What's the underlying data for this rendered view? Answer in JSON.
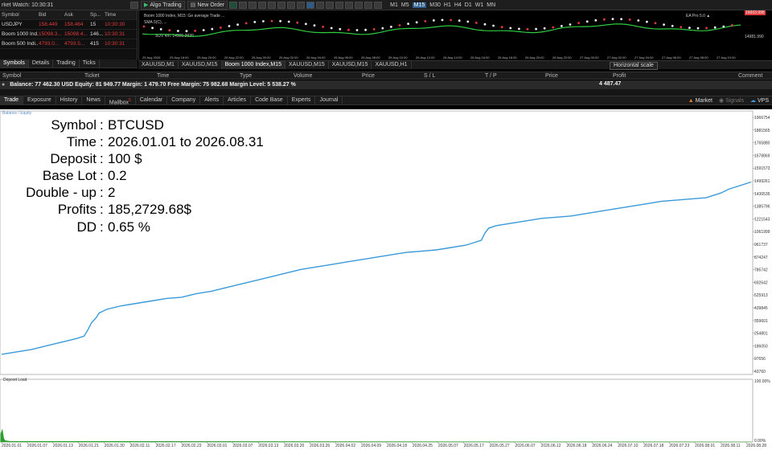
{
  "toolbar": {
    "market_watch_title": "rket Watch: 10:30:31",
    "algo_trading": "Algo Trading",
    "new_order": "New Order",
    "timeframes": [
      "M1",
      "M5",
      "M15",
      "M30",
      "H1",
      "H4",
      "D1",
      "W1",
      "MN"
    ],
    "active_timeframe": "M15"
  },
  "market_watch": {
    "headers": {
      "symbol": "Symbol",
      "bid": "Bid",
      "ask": "Ask",
      "spread": "Sp...",
      "time": "Time"
    },
    "rows": [
      {
        "symbol": "USDJPY",
        "bid": "158.449",
        "ask": "158.464",
        "spread": "15",
        "time": "10:30:30"
      },
      {
        "symbol": "Boom 1000 Ind...",
        "bid": "15098.3...",
        "ask": "15098.4...",
        "spread": "146...",
        "time": "10:30:31"
      },
      {
        "symbol": "Boom 500 Indi...",
        "bid": "4793.0...",
        "ask": "4793.5...",
        "spread": "415",
        "time": "10:30:31"
      }
    ],
    "tabs": [
      "Symbols",
      "Details",
      "Trading",
      "Ticks"
    ]
  },
  "mini_chart": {
    "line1": "Boom 1000 Index, M15:  Ge average  Trade ...",
    "line2": "SMA 5(C), ...",
    "line3": "SUV 4m: 14905.2930",
    "right_label": "EA Pro 5.0 ▲",
    "right_price1": "16003.995",
    "right_price2": "14981.990",
    "x_labels": [
      "25 Aug 2026",
      "25 Aug 18:00",
      "25 Aug 20:00",
      "25 Aug 22:00",
      "26 Aug 00:00",
      "26 Aug 02:00",
      "26 Aug 04:00",
      "26 Aug 06:00",
      "26 Aug 08:00",
      "26 Aug 10:00",
      "26 Aug 12:00",
      "26 Aug 14:00",
      "26 Aug 16:00",
      "26 Aug 18:00",
      "26 Aug 20:00",
      "26 Aug 22:00",
      "27 Aug 00:00",
      "27 Aug 02:00",
      "27 Aug 04:00",
      "27 Aug 06:00",
      "27 Aug 08:00",
      "27 Aug 10:00"
    ]
  },
  "chart_tabs": [
    "XAUUSD,M1",
    "XAUUSD,M15",
    "Boom 1000 Index,M15",
    "XAUUSD,M15",
    "XAUUSD,M15",
    "XAUUSD,H1"
  ],
  "active_chart_tab": 2,
  "horizontal_scale": "Horizontal scale",
  "trade_table": {
    "headers": [
      "Symbol",
      "Ticket",
      "Time",
      "Type",
      "Volume",
      "Price",
      "S / L",
      "T / P",
      "Price",
      "Profit",
      "Comment"
    ],
    "balance_line": "Balance: 77 462.30 USD  Equity: 81 949.77  Margin: 1 479.70  Free Margin: 75 982.68  Margin Level: 5 538.27 %",
    "profit_total": "4 487.47"
  },
  "bottom_tabs": [
    "Trade",
    "Exposure",
    "History",
    "News",
    "Mailbox",
    "Calendar",
    "Company",
    "Alerts",
    "Articles",
    "Code Base",
    "Experts",
    "Journal"
  ],
  "bottom_mailbox_badge": "5",
  "bottom_right": {
    "market": "Market",
    "signals": "Signals",
    "vps": "VPS"
  },
  "graph_legend": "Balance / Equity",
  "deposit_load_label": "Deposit Load",
  "stats": [
    {
      "label": "Symbol",
      "value": "BTCUSD"
    },
    {
      "label": "Time",
      "value": "2026.01.01 to 2026.08.31"
    },
    {
      "label": "Deposit",
      "value": "100 $"
    },
    {
      "label": "Base Lot",
      "value": "0.2"
    },
    {
      "label": "Double - up",
      "value": "2"
    },
    {
      "label": "Profits",
      "value": "185,2729.68$"
    },
    {
      "label": "DD",
      "value": "0.65 %"
    }
  ],
  "chart_data": {
    "type": "line",
    "title": "",
    "series": [
      {
        "name": "Balance",
        "color": "#3a9ad9"
      }
    ],
    "y_ticks": [
      "1966754",
      "1881565",
      "1765880",
      "1678869",
      "1591573",
      "1499261",
      "1436535",
      "1385796",
      "1221543",
      "1061999",
      "961737",
      "874247",
      "785742",
      "692642",
      "525913",
      "439845",
      "359601",
      "254801",
      "186050",
      "97656",
      "43760"
    ],
    "y_load_ticks": [
      "100.00%",
      "0.00%"
    ],
    "x_ticks": [
      "2026.01.01",
      "2026.01.07",
      "2026.01.13",
      "2026.01.21",
      "2026.01.30",
      "2026.02.11",
      "2026.02.17",
      "2026.02.23",
      "2026.03.01",
      "2026.03.07",
      "2026.03.13",
      "2026.03.20",
      "2026.03.26",
      "2026.04.02",
      "2026.04.09",
      "2026.04.18",
      "2026.04.25",
      "2026.05.07",
      "2026.05.17",
      "2026.05.27",
      "2026.06.07",
      "2026.06.12",
      "2026.06.18",
      "2026.06.24",
      "2026.07.10",
      "2026.07.18",
      "2026.07.23",
      "2026.08.01",
      "2026.08.11",
      "2026.08.28"
    ],
    "points": [
      [
        0,
        5
      ],
      [
        2,
        6
      ],
      [
        4,
        7
      ],
      [
        6,
        8.5
      ],
      [
        8,
        10
      ],
      [
        10,
        11.5
      ],
      [
        11,
        12.5
      ],
      [
        11.5,
        15
      ],
      [
        12,
        18
      ],
      [
        12.6,
        20
      ],
      [
        13,
        22
      ],
      [
        14,
        23.5
      ],
      [
        16,
        25
      ],
      [
        18,
        26
      ],
      [
        20,
        27
      ],
      [
        22,
        28
      ],
      [
        24,
        28.5
      ],
      [
        26,
        30
      ],
      [
        28,
        31
      ],
      [
        30,
        32.5
      ],
      [
        32,
        34
      ],
      [
        34,
        35.5
      ],
      [
        36,
        37
      ],
      [
        38,
        38.5
      ],
      [
        40,
        40
      ],
      [
        42,
        41
      ],
      [
        44,
        42
      ],
      [
        46,
        43
      ],
      [
        48,
        44
      ],
      [
        50,
        45
      ],
      [
        52,
        46
      ],
      [
        54,
        47
      ],
      [
        56,
        47.5
      ],
      [
        58,
        48
      ],
      [
        60,
        49
      ],
      [
        62,
        50
      ],
      [
        63,
        51
      ],
      [
        64,
        52
      ],
      [
        64.5,
        55
      ],
      [
        65,
        57
      ],
      [
        66,
        58
      ],
      [
        68,
        59
      ],
      [
        70,
        60
      ],
      [
        72,
        61
      ],
      [
        74,
        61.5
      ],
      [
        76,
        62
      ],
      [
        78,
        63
      ],
      [
        80,
        64
      ],
      [
        82,
        65
      ],
      [
        84,
        66
      ],
      [
        86,
        67
      ],
      [
        88,
        68
      ],
      [
        90,
        68.5
      ],
      [
        92,
        69
      ],
      [
        94,
        69.5
      ],
      [
        95,
        70.5
      ],
      [
        96,
        71.5
      ],
      [
        97,
        73
      ],
      [
        98,
        74
      ],
      [
        99,
        75
      ],
      [
        100,
        76
      ]
    ],
    "load_points": [
      [
        0,
        13
      ],
      [
        0.2,
        20
      ],
      [
        0.4,
        5
      ],
      [
        0.6,
        2
      ],
      [
        1.2,
        1
      ],
      [
        100,
        0
      ]
    ]
  }
}
